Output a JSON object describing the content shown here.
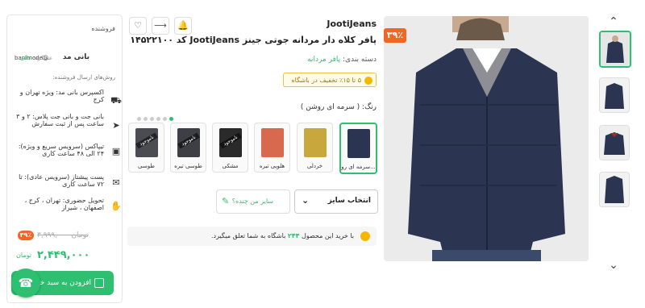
{
  "product": {
    "brand": "JootiJeans",
    "title": "پافر کلاه دار مردانه جوتی جینز JootiJeans کد ۱۴۵۲۲۱۰۰",
    "category_label": "دسته بندی:",
    "category_value": "پافر مردانه",
    "promo": "۵ تا ۱۵٪ تخفیف در باشگاه",
    "discount_badge": "۳۹٪",
    "color_label": "رنگ:",
    "color_value": "( سرمه ای روشن )"
  },
  "swatches": [
    {
      "label": "سرمه ای رو...",
      "color": "#2b3450",
      "available": true,
      "active": true
    },
    {
      "label": "خردلی",
      "color": "#c8a83c",
      "available": true,
      "active": false
    },
    {
      "label": "هلویی تیره",
      "color": "#d9694e",
      "available": true,
      "active": false
    },
    {
      "label": "مشکی",
      "color": "#2a2a2a",
      "available": false,
      "active": false
    },
    {
      "label": "طوسی تیره",
      "color": "#3d3f44",
      "available": false,
      "active": false
    },
    {
      "label": "طوسی",
      "color": "#4a4c52",
      "available": false,
      "active": false
    }
  ],
  "unavailable_label": "ناموجود",
  "size": {
    "select_label": "انتخاب سایز",
    "guide_label": "سایز من چنده؟"
  },
  "points": {
    "prefix": "با خرید این محصول",
    "count": "۲۴۴",
    "suffix": "باشگاه به شما تعلق میگیرد."
  },
  "seller": {
    "header": "فروشنده",
    "name": "بانی مد",
    "handle": "@banimode",
    "performance_label": "عملکرد:",
    "performance_value": "عالی",
    "shipping_title": "روش‌های ارسال فروشنده:",
    "shipping": [
      {
        "text": "اکسپرس بانی مد: ویژه تهران و کرج",
        "icon": "truck-icon"
      },
      {
        "text": "بانی جت و بانی جت پلاس: ۲ و ۳ ساعت پس از ثبت سفارش",
        "icon": "rocket-icon"
      },
      {
        "text": "تیپاکس (سرویس سریع و ویژه): ۲۴ الی ۴۸ ساعت کاری",
        "icon": "box-icon"
      },
      {
        "text": "پست پیشتاز (سرویس عادی): تا ۷۲ ساعت کاری",
        "icon": "post-icon"
      },
      {
        "text": "تحویل حضوری: تهران ، کرج ، اصفهان ، شیراز",
        "icon": "handover-icon"
      }
    ],
    "old_price": "۳,۹۹۹,۰۰۰",
    "old_price_unit": "تومان",
    "discount": "۳۹٪",
    "price": "۲,۴۴۹,۰۰۰",
    "price_unit": "تومان",
    "add_to_cart": "افزودن به سبد خرید"
  },
  "colors": {
    "accent": "#2fbf71",
    "discount": "#f26522",
    "jacket": "#2b3450"
  }
}
